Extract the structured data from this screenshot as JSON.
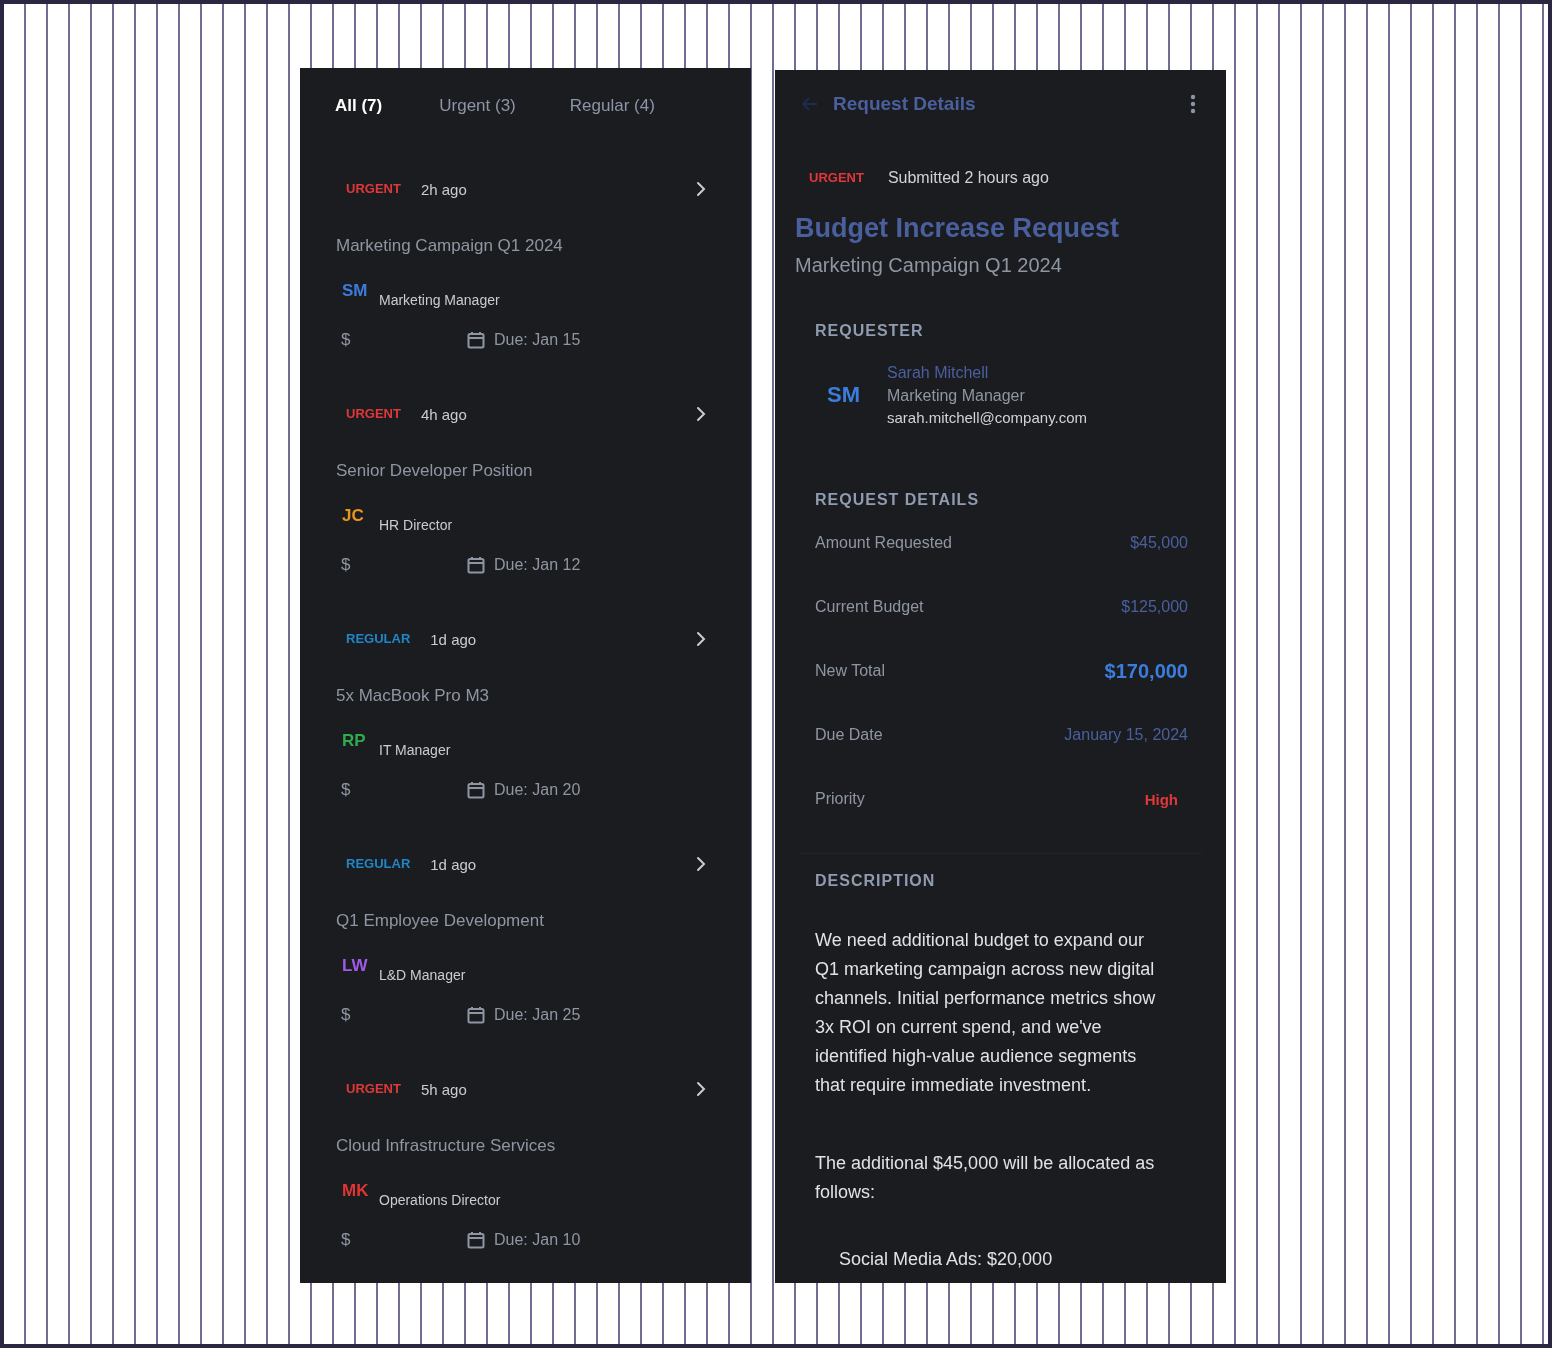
{
  "list_panel": {
    "tabs": [
      {
        "label": "All (7)",
        "selected": true
      },
      {
        "label": "Urgent (3)",
        "selected": false
      },
      {
        "label": "Regular (4)",
        "selected": false
      }
    ],
    "requests": [
      {
        "kind": "urgent",
        "priority": "URGENT",
        "time": "2h ago",
        "subtitle": "Marketing Campaign Q1 2024",
        "initials": "SM",
        "color": "#3b7ddd",
        "role": "Marketing Manager",
        "currency": "$",
        "due": "Due: Jan 15"
      },
      {
        "kind": "urgent",
        "priority": "URGENT",
        "time": "4h ago",
        "subtitle": "Senior Developer Position",
        "initials": "JC",
        "color": "#e8961e",
        "role": "HR Director",
        "currency": "$",
        "due": "Due: Jan 12"
      },
      {
        "kind": "regular",
        "priority": "REGULAR",
        "time": "1d ago",
        "subtitle": "5x MacBook Pro M3",
        "initials": "RP",
        "color": "#2eaa4f",
        "role": "IT Manager",
        "currency": "$",
        "due": "Due: Jan 20"
      },
      {
        "kind": "regular",
        "priority": "REGULAR",
        "time": "1d ago",
        "subtitle": "Q1 Employee Development",
        "initials": "LW",
        "color": "#a259e6",
        "role": "L&D Manager",
        "currency": "$",
        "due": "Due: Jan 25"
      },
      {
        "kind": "urgent",
        "priority": "URGENT",
        "time": "5h ago",
        "subtitle": "Cloud Infrastructure Services",
        "initials": "MK",
        "color": "#e03535",
        "role": "Operations Director",
        "currency": "$",
        "due": "Due: Jan 10"
      }
    ]
  },
  "detail_panel": {
    "header_title": "Request Details",
    "priority": {
      "kind": "urgent",
      "label": "URGENT"
    },
    "submitted": "Submitted 2 hours ago",
    "title": "Budget Increase Request",
    "subtitle": "Marketing Campaign Q1 2024",
    "requester": {
      "heading": "REQUESTER",
      "initials": "SM",
      "color": "#3b7ddd",
      "name": "Sarah Mitchell",
      "role": "Marketing Manager",
      "email": "sarah.mitchell@company.com"
    },
    "details": {
      "heading": "REQUEST DETAILS",
      "rows": [
        {
          "label": "Amount Requested",
          "value": "$45,000",
          "kind": "muted"
        },
        {
          "label": "Current Budget",
          "value": "$125,000",
          "kind": "muted"
        },
        {
          "label": "New Total",
          "value": "$170,000",
          "kind": "highlight"
        },
        {
          "label": "Due Date",
          "value": "January 15, 2024",
          "kind": "muted"
        },
        {
          "label": "Priority",
          "value": "High",
          "kind": "high"
        }
      ]
    },
    "description": {
      "heading": "DESCRIPTION",
      "paragraphs": [
        "We need additional budget to expand our Q1 marketing campaign across new digital channels. Initial performance metrics show 3x ROI on current spend, and we've identified high-value audience segments that require immediate investment.",
        "The additional $45,000 will be allocated as follows:"
      ],
      "items": [
        "Social Media Ads: $20,000"
      ]
    }
  }
}
